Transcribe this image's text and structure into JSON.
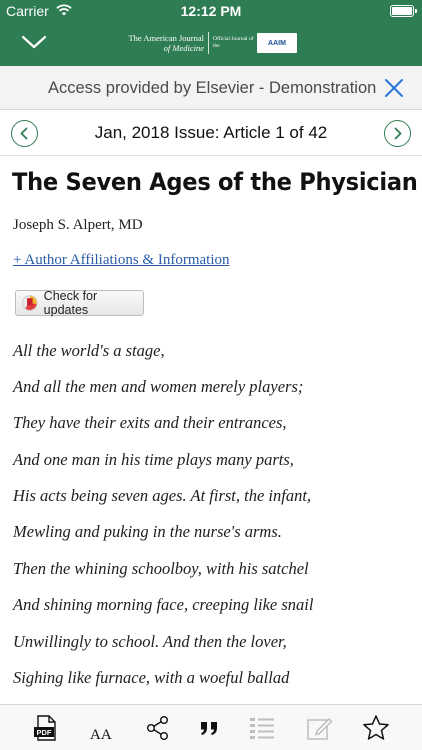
{
  "status_bar": {
    "carrier": "Carrier",
    "time": "12:12 PM",
    "battery_level": 1.0
  },
  "nav": {
    "collapse_icon": "chevron-down-icon",
    "journal_logo": {
      "line1": "The American Journal",
      "line2": "of Medicine",
      "official": "Official Journal of the",
      "badge": "AAIM"
    }
  },
  "access_banner": {
    "text": "Access provided by Elsevier - Demonstration",
    "close_icon": "close-icon"
  },
  "issue_nav": {
    "label": "Jan, 2018 Issue: Article 1 of 42",
    "prev_icon": "chevron-left-circle-icon",
    "next_icon": "chevron-right-circle-icon"
  },
  "article": {
    "title": "The Seven Ages of the Physician",
    "author": "Joseph S. Alpert, MD",
    "affiliations_link": "+ Author Affiliations & Information",
    "check_updates_label": "Check for updates",
    "poem_lines": [
      "All the world's a stage,",
      "And all the men and women merely players;",
      "They have their exits and their entrances,",
      "And one man in his time plays many parts,",
      "His acts being seven ages. At first, the infant,",
      "Mewling and puking in the nurse's arms.",
      "Then the whining schoolboy, with his satchel",
      "And shining morning face, creeping like snail",
      "Unwillingly to school. And then the lover,",
      "Sighing like furnace, with a woeful ballad"
    ]
  },
  "toolbar": {
    "pdf_label": "PDF",
    "text_size_label": "AA",
    "icons": [
      "pdf-icon",
      "text-size-icon",
      "share-icon",
      "quote-icon",
      "list-icon",
      "edit-icon",
      "star-icon"
    ]
  },
  "colors": {
    "brand_green": "#2f7d53",
    "link_blue": "#2a5da8",
    "close_blue": "#2b79d6"
  }
}
